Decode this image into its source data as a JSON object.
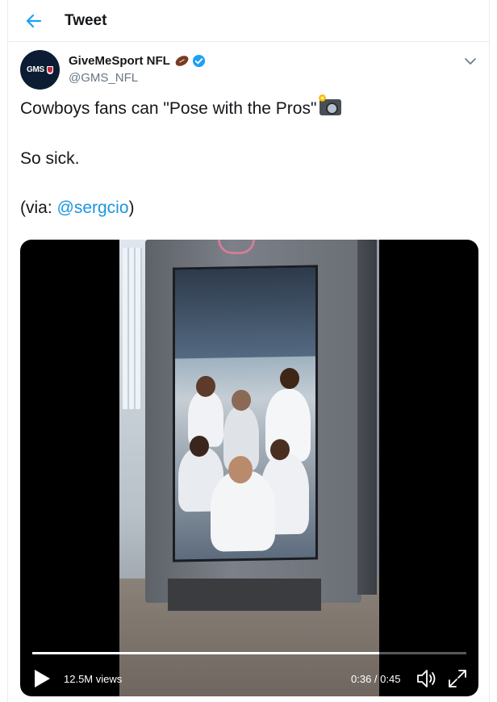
{
  "header": {
    "title": "Tweet",
    "back_icon": "arrow-left-icon"
  },
  "author": {
    "avatar_text": "GMS",
    "display_name": "GiveMeSport NFL",
    "handle": "@GMS_NFL",
    "badges": [
      "football-icon",
      "verified-icon"
    ],
    "menu_icon": "chevron-down-icon"
  },
  "tweet": {
    "line1": "Cowboys fans can \"Pose with the Pros\"",
    "line1_emoji": "camera-with-flash-icon",
    "line2": "So sick.",
    "line3_prefix": "(via: ",
    "line3_mention": "@sergcio",
    "line3_suffix": ")"
  },
  "video": {
    "views": "12.5M views",
    "time": "0:36 / 0:45",
    "progress": 0.8,
    "controls": [
      "play-icon",
      "volume-icon",
      "fullscreen-icon"
    ]
  },
  "colors": {
    "accent": "#1b95e0",
    "verified": "#1da1f2",
    "text_primary": "#14171a",
    "text_secondary": "#657786"
  }
}
